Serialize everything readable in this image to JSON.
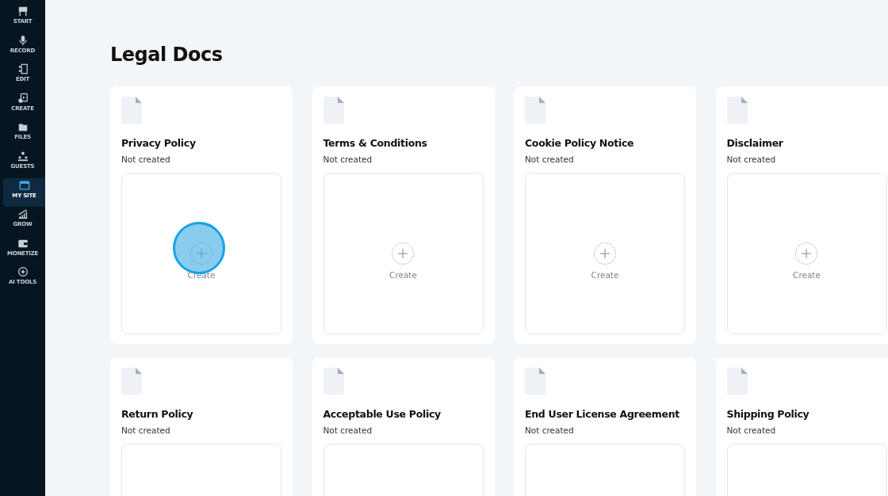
{
  "sidebar": {
    "items": [
      {
        "label": "START",
        "selected": false
      },
      {
        "label": "RECORD",
        "selected": false
      },
      {
        "label": "EDIT",
        "selected": false
      },
      {
        "label": "CREATE",
        "selected": false
      },
      {
        "label": "FILES",
        "selected": false
      },
      {
        "label": "GUESTS",
        "selected": false
      },
      {
        "label": "MY SITE",
        "selected": true
      },
      {
        "label": "GROW",
        "selected": false
      },
      {
        "label": "MONETIZE",
        "selected": false
      },
      {
        "label": "AI TOOLS",
        "selected": false
      }
    ]
  },
  "page_title": "Legal Docs",
  "documents": [
    {
      "title": "Privacy Policy",
      "status": "Not created",
      "action": "Create",
      "highlighted": true
    },
    {
      "title": "Terms & Conditions",
      "status": "Not created",
      "action": "Create",
      "highlighted": false
    },
    {
      "title": "Cookie Policy Notice",
      "status": "Not created",
      "action": "Create",
      "highlighted": false
    },
    {
      "title": "Disclaimer",
      "status": "Not created",
      "action": "Create",
      "highlighted": false
    },
    {
      "title": "Return Policy",
      "status": "Not created"
    },
    {
      "title": "Acceptable Use Policy",
      "status": "Not created"
    },
    {
      "title": "End User License Agreement",
      "status": "Not created"
    },
    {
      "title": "Shipping Policy",
      "status": "Not created"
    }
  ]
}
